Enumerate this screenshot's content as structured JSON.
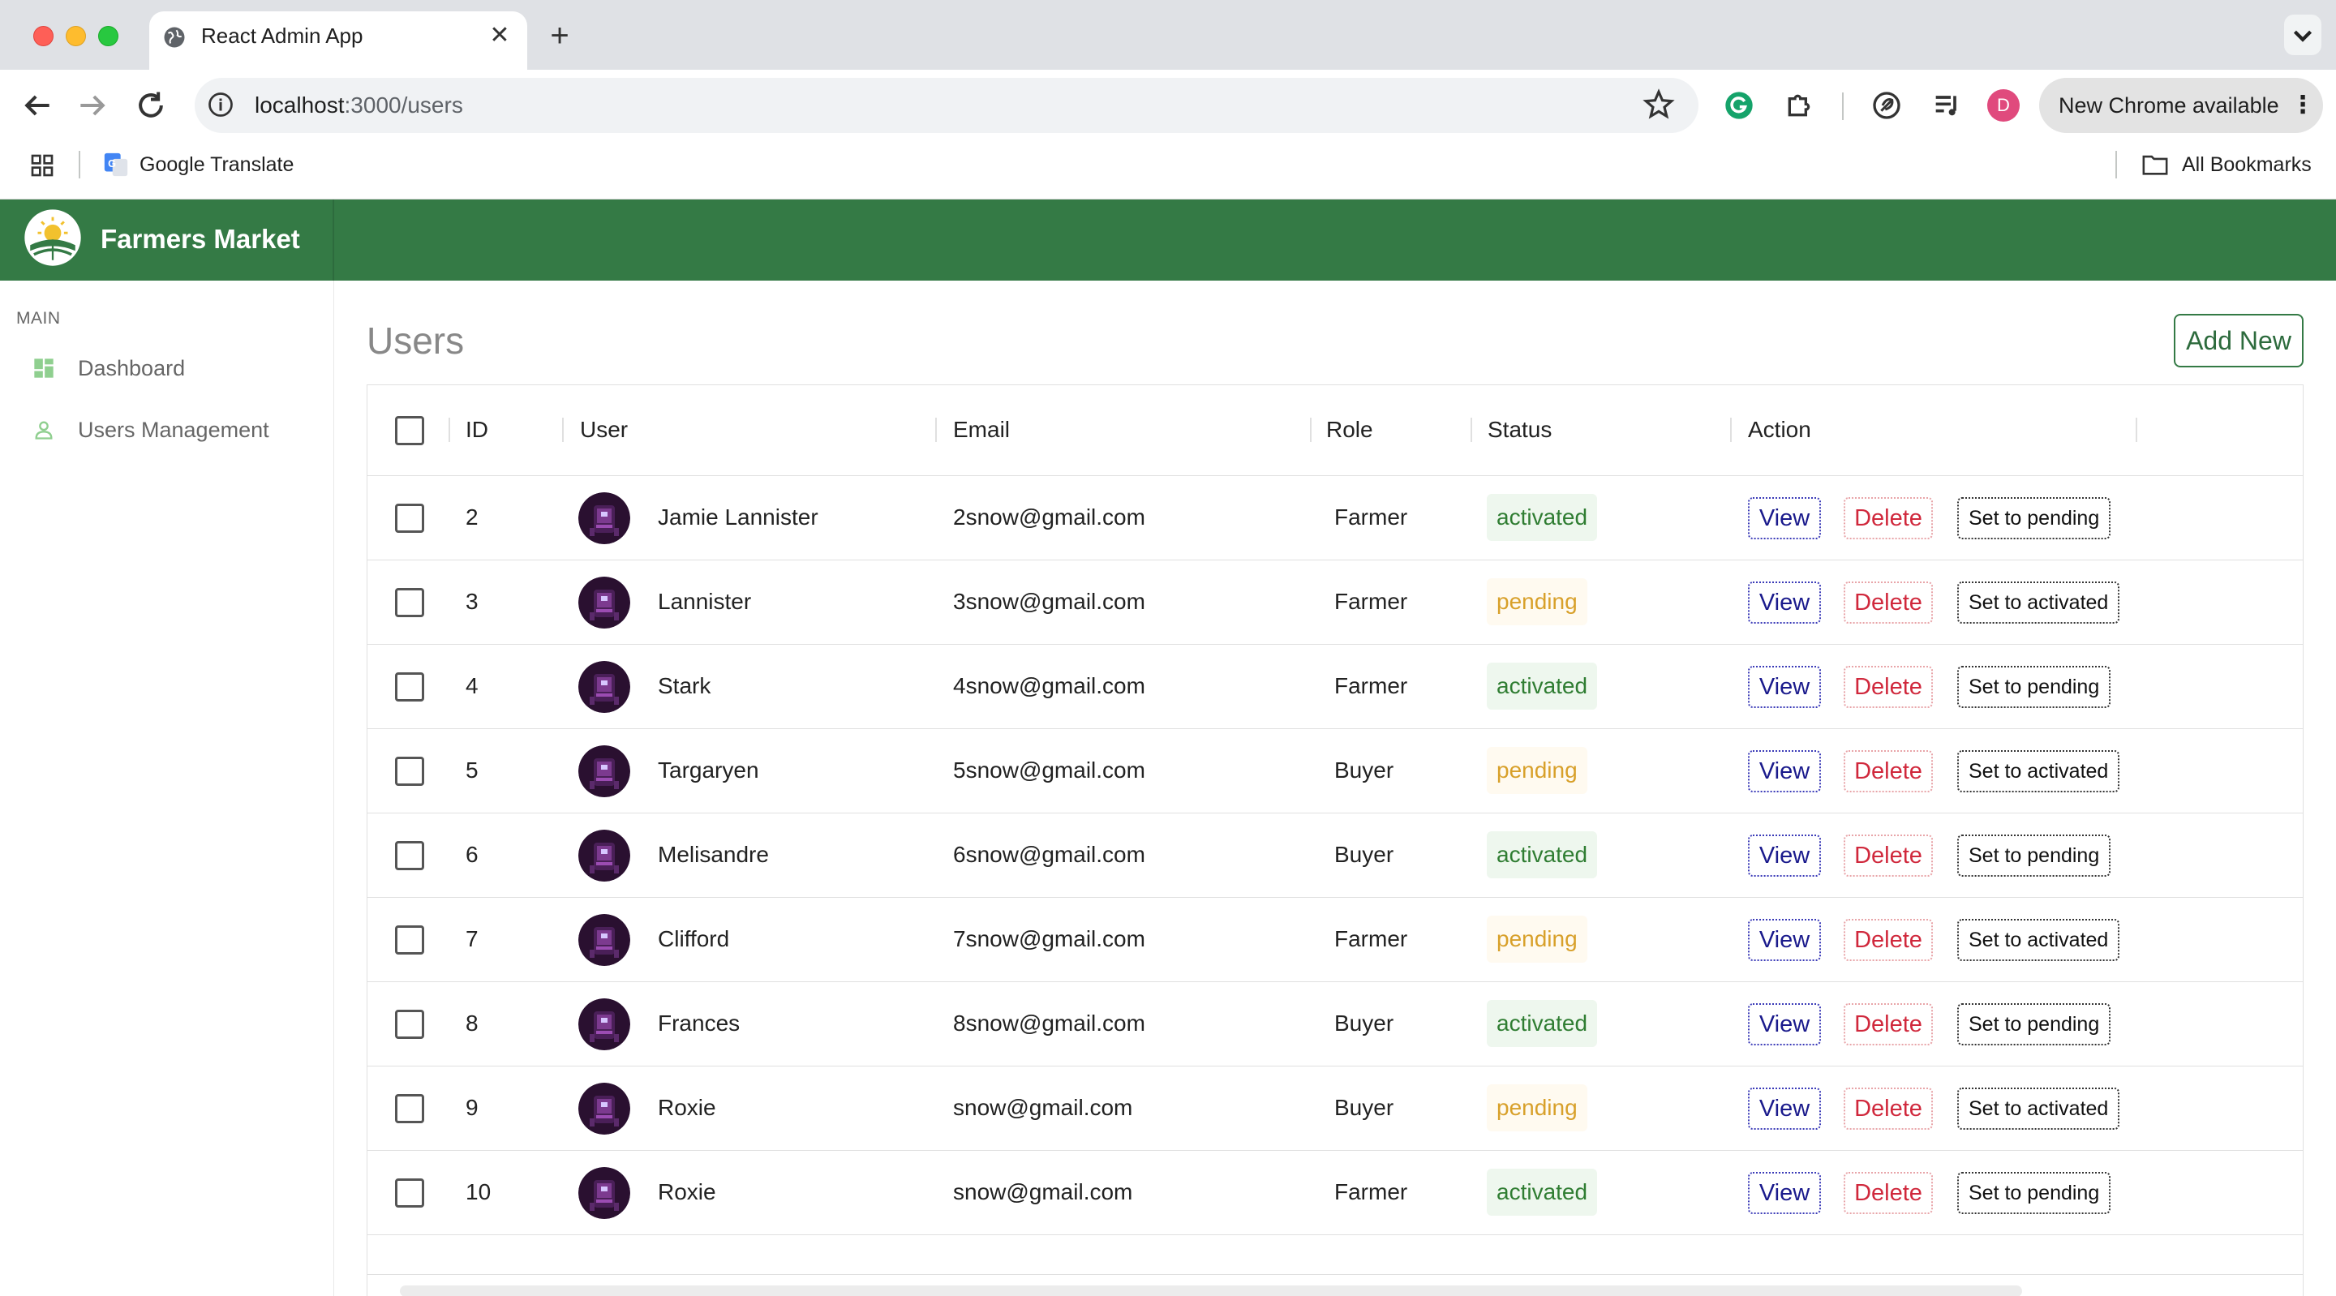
{
  "browser": {
    "tab_title": "React Admin App",
    "url_host": "localhost",
    "url_path": ":3000/users",
    "update_label": "New Chrome available",
    "profile_initial": "D",
    "bookmarks": [
      {
        "label": "Google Translate",
        "icon": "google-translate-icon"
      }
    ],
    "all_bookmarks_label": "All Bookmarks"
  },
  "app": {
    "brand": "Farmers Market",
    "brand_color": "#347a45",
    "sidebar": {
      "section_title": "MAIN",
      "items": [
        {
          "label": "Dashboard",
          "icon": "dashboard-icon"
        },
        {
          "label": "Users Management",
          "icon": "user-icon"
        }
      ]
    },
    "page_title": "Users",
    "add_new_label": "Add New",
    "table": {
      "columns": [
        "ID",
        "User",
        "Email",
        "Role",
        "Status",
        "Action"
      ],
      "action_labels": {
        "view": "View",
        "delete": "Delete"
      },
      "rows": [
        {
          "id": "2",
          "user": "Jamie Lannister",
          "email": "2snow@gmail.com",
          "role": "Farmer",
          "status": "activated",
          "toggle": "Set to pending"
        },
        {
          "id": "3",
          "user": "Lannister",
          "email": "3snow@gmail.com",
          "role": "Farmer",
          "status": "pending",
          "toggle": "Set to activated"
        },
        {
          "id": "4",
          "user": "Stark",
          "email": "4snow@gmail.com",
          "role": "Farmer",
          "status": "activated",
          "toggle": "Set to pending"
        },
        {
          "id": "5",
          "user": "Targaryen",
          "email": "5snow@gmail.com",
          "role": "Buyer",
          "status": "pending",
          "toggle": "Set to activated"
        },
        {
          "id": "6",
          "user": "Melisandre",
          "email": "6snow@gmail.com",
          "role": "Buyer",
          "status": "activated",
          "toggle": "Set to pending"
        },
        {
          "id": "7",
          "user": "Clifford",
          "email": "7snow@gmail.com",
          "role": "Farmer",
          "status": "pending",
          "toggle": "Set to activated"
        },
        {
          "id": "8",
          "user": "Frances",
          "email": "8snow@gmail.com",
          "role": "Buyer",
          "status": "activated",
          "toggle": "Set to pending"
        },
        {
          "id": "9",
          "user": "Roxie",
          "email": "snow@gmail.com",
          "role": "Buyer",
          "status": "pending",
          "toggle": "Set to activated"
        },
        {
          "id": "10",
          "user": "Roxie",
          "email": "snow@gmail.com",
          "role": "Farmer",
          "status": "activated",
          "toggle": "Set to pending"
        }
      ]
    }
  }
}
